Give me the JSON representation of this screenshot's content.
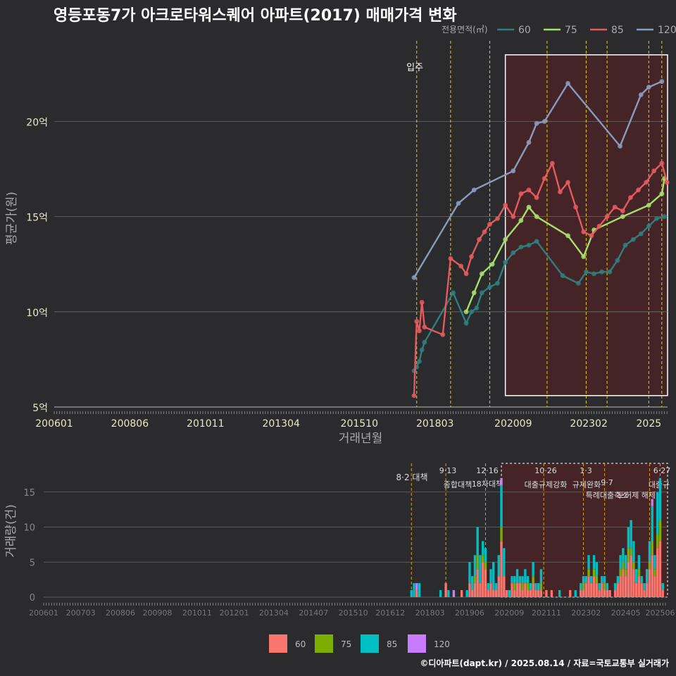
{
  "title": "영등포동7가 아크로타워스퀘어 아파트(2017) 매매가격 변화",
  "footer": "©디아파트(dapt.kr) / 2025.08.14 / 자료=국토교통부 실거래가",
  "colors": {
    "background": "#2b2b2d",
    "grid": "#6a6a6a",
    "s60": "#2e7f7d",
    "s75": "#a6df6e",
    "s85": "#e55a5e",
    "s120": "#8a9bbd",
    "vol60": "#f8766d",
    "vol75": "#7cae00",
    "vol85": "#00bfc4",
    "vol120": "#c77cff",
    "policy_line": "#e6d200",
    "highlight_fill": "#4a2328"
  },
  "chart_data": [
    {
      "type": "line",
      "xlabel": "거래년월",
      "ylabel": "평균가(원)",
      "x_ticks": [
        "200601",
        "200806",
        "201011",
        "201304",
        "201510",
        "201803",
        "202009",
        "202302",
        "2025"
      ],
      "y_ticks": [
        "5억",
        "10억",
        "15억",
        "20억"
      ],
      "ylim": [
        5,
        23.5
      ],
      "legend_title": "전용면적(㎡)",
      "legend_position": "top-right",
      "annotations": [
        {
          "label": "입주",
          "x": "2017-07"
        }
      ],
      "policy_lines": [
        "2017-08",
        "2018-09",
        "2019-12",
        "2021-10",
        "2023-01",
        "2023-09",
        "2025-01",
        "2025-06"
      ],
      "highlight": {
        "x_start": "2020-06",
        "x_end": "2025-08",
        "y_start": 5.6,
        "y_end": 23.5
      },
      "series": [
        {
          "name": "60",
          "points": [
            [
              "2017-07",
              6.9
            ],
            [
              "2017-08",
              7.1
            ],
            [
              "2017-09",
              7.4
            ],
            [
              "2017-10",
              8.0
            ],
            [
              "2017-11",
              8.4
            ],
            [
              "2018-10",
              11.0
            ],
            [
              "2019-03",
              9.4
            ],
            [
              "2019-05",
              10.0
            ],
            [
              "2019-07",
              10.2
            ],
            [
              "2019-09",
              11.0
            ],
            [
              "2019-12",
              11.3
            ],
            [
              "2020-03",
              11.5
            ],
            [
              "2020-06",
              12.6
            ],
            [
              "2020-09",
              13.1
            ],
            [
              "2020-12",
              13.4
            ],
            [
              "2021-03",
              13.5
            ],
            [
              "2021-06",
              13.7
            ],
            [
              "2022-04",
              11.9
            ],
            [
              "2022-10",
              11.5
            ],
            [
              "2023-01",
              12.1
            ],
            [
              "2023-04",
              12.0
            ],
            [
              "2023-07",
              12.1
            ],
            [
              "2023-10",
              12.1
            ],
            [
              "2024-01",
              12.7
            ],
            [
              "2024-04",
              13.5
            ],
            [
              "2024-07",
              13.8
            ],
            [
              "2024-10",
              14.1
            ],
            [
              "2025-01",
              14.5
            ],
            [
              "2025-04",
              14.9
            ],
            [
              "2025-07",
              15.0
            ]
          ]
        },
        {
          "name": "75",
          "points": [
            [
              "2019-03",
              10.0
            ],
            [
              "2019-06",
              11.0
            ],
            [
              "2019-09",
              12.0
            ],
            [
              "2020-01",
              12.5
            ],
            [
              "2020-06",
              13.8
            ],
            [
              "2020-12",
              14.8
            ],
            [
              "2021-03",
              15.5
            ],
            [
              "2021-06",
              15.0
            ],
            [
              "2022-06",
              14.0
            ],
            [
              "2022-12",
              12.9
            ],
            [
              "2023-04",
              14.3
            ],
            [
              "2024-03",
              15.0
            ],
            [
              "2025-01",
              15.6
            ],
            [
              "2025-06",
              16.2
            ],
            [
              "2025-07",
              17.0
            ]
          ]
        },
        {
          "name": "85",
          "points": [
            [
              "2017-07",
              5.6
            ],
            [
              "2017-08",
              9.5
            ],
            [
              "2017-09",
              9.0
            ],
            [
              "2017-10",
              10.5
            ],
            [
              "2017-11",
              9.2
            ],
            [
              "2018-06",
              8.8
            ],
            [
              "2018-09",
              12.8
            ],
            [
              "2019-01",
              12.4
            ],
            [
              "2019-03",
              12.0
            ],
            [
              "2019-05",
              12.9
            ],
            [
              "2019-08",
              13.8
            ],
            [
              "2019-10",
              14.2
            ],
            [
              "2019-12",
              14.6
            ],
            [
              "2020-03",
              14.9
            ],
            [
              "2020-06",
              15.6
            ],
            [
              "2020-09",
              15.0
            ],
            [
              "2020-12",
              16.2
            ],
            [
              "2021-03",
              16.4
            ],
            [
              "2021-06",
              16.0
            ],
            [
              "2021-09",
              17.0
            ],
            [
              "2021-12",
              17.8
            ],
            [
              "2022-03",
              16.3
            ],
            [
              "2022-06",
              16.8
            ],
            [
              "2022-09",
              15.5
            ],
            [
              "2022-12",
              14.2
            ],
            [
              "2023-03",
              14.0
            ],
            [
              "2023-06",
              14.5
            ],
            [
              "2023-09",
              15.0
            ],
            [
              "2023-12",
              15.5
            ],
            [
              "2024-03",
              15.3
            ],
            [
              "2024-06",
              16.0
            ],
            [
              "2024-09",
              16.4
            ],
            [
              "2024-12",
              16.8
            ],
            [
              "2025-03",
              17.4
            ],
            [
              "2025-06",
              17.8
            ],
            [
              "2025-08",
              16.8
            ]
          ]
        },
        {
          "name": "120",
          "points": [
            [
              "2017-07",
              11.8
            ],
            [
              "2018-12",
              15.7
            ],
            [
              "2019-06",
              16.4
            ],
            [
              "2020-09",
              17.4
            ],
            [
              "2021-03",
              18.9
            ],
            [
              "2021-06",
              19.9
            ],
            [
              "2021-09",
              20.0
            ],
            [
              "2022-06",
              22.0
            ],
            [
              "2024-02",
              18.7
            ],
            [
              "2024-10",
              21.4
            ],
            [
              "2025-01",
              21.8
            ],
            [
              "2025-06",
              22.1
            ]
          ]
        }
      ]
    },
    {
      "type": "bar",
      "stacked": true,
      "ylabel": "거래량(건)",
      "y_ticks": [
        "0",
        "5",
        "10",
        "15"
      ],
      "ylim": [
        0,
        18
      ],
      "x_ticks": [
        "200601",
        "200703",
        "200806",
        "200908",
        "201011",
        "201201",
        "201304",
        "201407",
        "201510",
        "201612",
        "201803",
        "201906",
        "202009",
        "202111",
        "202302",
        "202405",
        "202506"
      ],
      "legend_position": "bottom",
      "series_names": [
        "60",
        "75",
        "85",
        "120"
      ],
      "policies": [
        {
          "date": "8·2 대책",
          "label": "8·2 대책"
        },
        {
          "date": "9·13",
          "label": "종합대책"
        },
        {
          "date": "12·16",
          "label": "18차대책"
        },
        {
          "date": "10·26",
          "label": "대출규제강화"
        },
        {
          "date": "1·3",
          "label": "규제완화"
        },
        {
          "date": "9·7",
          "label": "특례대출축소"
        },
        {
          "date": "토허제 해제",
          "label": ""
        },
        {
          "date": "6·27",
          "label": "대출규"
        }
      ],
      "months": [
        [
          "2017-08",
          [
            0,
            0,
            1,
            0
          ]
        ],
        [
          "2017-09",
          [
            0,
            0,
            2,
            0
          ]
        ],
        [
          "2017-10",
          [
            1,
            0,
            0,
            1
          ]
        ],
        [
          "2017-11",
          [
            0,
            0,
            2,
            0
          ]
        ],
        [
          "2018-07",
          [
            0,
            0,
            1,
            0
          ]
        ],
        [
          "2018-09",
          [
            2,
            0,
            0,
            0
          ]
        ],
        [
          "2018-10",
          [
            0,
            0,
            1,
            0
          ]
        ],
        [
          "2018-12",
          [
            0,
            0,
            0,
            1
          ]
        ],
        [
          "2019-03",
          [
            1,
            0,
            0,
            0
          ]
        ],
        [
          "2019-05",
          [
            0,
            0,
            1,
            0
          ]
        ],
        [
          "2019-06",
          [
            2,
            0,
            3,
            0
          ]
        ],
        [
          "2019-07",
          [
            1,
            0,
            2,
            0
          ]
        ],
        [
          "2019-08",
          [
            2,
            1,
            3,
            0
          ]
        ],
        [
          "2019-09",
          [
            4,
            2,
            4,
            0
          ]
        ],
        [
          "2019-10",
          [
            2,
            0,
            4,
            0
          ]
        ],
        [
          "2019-11",
          [
            5,
            1,
            2,
            0
          ]
        ],
        [
          "2019-12",
          [
            4,
            1,
            2,
            0
          ]
        ],
        [
          "2020-01",
          [
            1,
            0,
            1,
            0
          ]
        ],
        [
          "2020-02",
          [
            2,
            0,
            2,
            0
          ]
        ],
        [
          "2020-03",
          [
            1,
            0,
            4,
            0
          ]
        ],
        [
          "2020-04",
          [
            1,
            0,
            1,
            0
          ]
        ],
        [
          "2020-05",
          [
            3,
            0,
            3,
            0
          ]
        ],
        [
          "2020-06",
          [
            8,
            2,
            6,
            1
          ]
        ],
        [
          "2020-07",
          [
            3,
            0,
            4,
            0
          ]
        ],
        [
          "2020-08",
          [
            1,
            0,
            0,
            0
          ]
        ],
        [
          "2020-09",
          [
            0,
            0,
            1,
            0
          ]
        ],
        [
          "2020-10",
          [
            2,
            0,
            1,
            0
          ]
        ],
        [
          "2020-11",
          [
            1,
            1,
            1,
            0
          ]
        ],
        [
          "2020-12",
          [
            2,
            0,
            2,
            0
          ]
        ],
        [
          "2021-01",
          [
            2,
            0,
            1,
            0
          ]
        ],
        [
          "2021-02",
          [
            1,
            1,
            1,
            0
          ]
        ],
        [
          "2021-03",
          [
            2,
            0,
            2,
            0
          ]
        ],
        [
          "2021-04",
          [
            1,
            1,
            1,
            0
          ]
        ],
        [
          "2021-05",
          [
            1,
            0,
            1,
            0
          ]
        ],
        [
          "2021-06",
          [
            2,
            1,
            2,
            0
          ]
        ],
        [
          "2021-07",
          [
            1,
            0,
            1,
            0
          ]
        ],
        [
          "2021-08",
          [
            1,
            0,
            1,
            0
          ]
        ],
        [
          "2021-09",
          [
            1,
            1,
            2,
            0
          ]
        ],
        [
          "2021-11",
          [
            1,
            0,
            0,
            0
          ]
        ],
        [
          "2022-01",
          [
            1,
            0,
            0,
            0
          ]
        ],
        [
          "2022-04",
          [
            0,
            0,
            1,
            0
          ]
        ],
        [
          "2022-08",
          [
            1,
            0,
            0,
            0
          ]
        ],
        [
          "2022-10",
          [
            0,
            0,
            1,
            0
          ]
        ],
        [
          "2022-12",
          [
            1,
            0,
            1,
            0
          ]
        ],
        [
          "2023-01",
          [
            1,
            1,
            1,
            0
          ]
        ],
        [
          "2023-02",
          [
            2,
            0,
            1,
            0
          ]
        ],
        [
          "2023-03",
          [
            3,
            1,
            2,
            0
          ]
        ],
        [
          "2023-04",
          [
            2,
            0,
            1,
            0
          ]
        ],
        [
          "2023-05",
          [
            3,
            1,
            2,
            0
          ]
        ],
        [
          "2023-06",
          [
            2,
            1,
            2,
            0
          ]
        ],
        [
          "2023-07",
          [
            1,
            0,
            1,
            0
          ]
        ],
        [
          "2023-08",
          [
            2,
            0,
            1,
            0
          ]
        ],
        [
          "2023-09",
          [
            1,
            1,
            1,
            0
          ]
        ],
        [
          "2023-10",
          [
            1,
            0,
            1,
            0
          ]
        ],
        [
          "2023-11",
          [
            1,
            0,
            0,
            0
          ]
        ],
        [
          "2024-01",
          [
            1,
            0,
            1,
            0
          ]
        ],
        [
          "2024-02",
          [
            2,
            0,
            1,
            0
          ]
        ],
        [
          "2024-03",
          [
            3,
            1,
            2,
            0
          ]
        ],
        [
          "2024-04",
          [
            4,
            1,
            2,
            0
          ]
        ],
        [
          "2024-05",
          [
            3,
            1,
            2,
            0
          ]
        ],
        [
          "2024-06",
          [
            5,
            2,
            3,
            0
          ]
        ],
        [
          "2024-07",
          [
            6,
            1,
            4,
            0
          ]
        ],
        [
          "2024-08",
          [
            4,
            1,
            3,
            0
          ]
        ],
        [
          "2024-09",
          [
            2,
            0,
            2,
            0
          ]
        ],
        [
          "2024-10",
          [
            3,
            1,
            2,
            0
          ]
        ],
        [
          "2024-11",
          [
            2,
            0,
            1,
            0
          ]
        ],
        [
          "2024-12",
          [
            1,
            0,
            1,
            0
          ]
        ],
        [
          "2025-01",
          [
            2,
            0,
            2,
            0
          ]
        ],
        [
          "2025-02",
          [
            4,
            1,
            3,
            0
          ]
        ],
        [
          "2025-03",
          [
            6,
            2,
            5,
            1
          ]
        ],
        [
          "2025-04",
          [
            3,
            1,
            2,
            0
          ]
        ],
        [
          "2025-05",
          [
            7,
            2,
            6,
            0
          ]
        ],
        [
          "2025-06",
          [
            8,
            3,
            6,
            0
          ]
        ],
        [
          "2025-07",
          [
            1,
            0,
            1,
            0
          ]
        ]
      ]
    }
  ]
}
